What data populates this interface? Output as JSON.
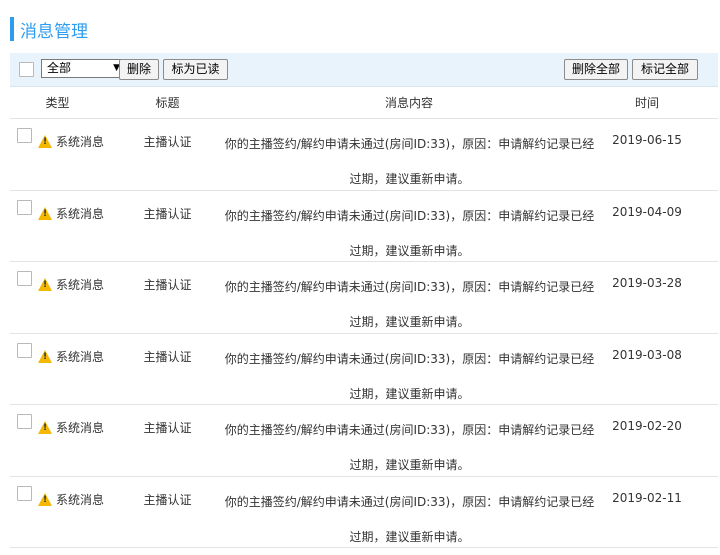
{
  "header": {
    "title": "消息管理"
  },
  "toolbar": {
    "filter_value": "全部",
    "delete_label": "删除",
    "mark_read_label": "标为已读",
    "delete_all_label": "删除全部",
    "mark_all_label": "标记全部"
  },
  "table": {
    "columns": {
      "type": "类型",
      "title": "标题",
      "content": "消息内容",
      "time": "时间"
    },
    "rows": [
      {
        "type": "系统消息",
        "title": "主播认证",
        "content": "你的主播签约/解约申请未通过(房间ID:33)，原因：申请解约记录已经过期，建议重新申请。",
        "time": "2019-06-15"
      },
      {
        "type": "系统消息",
        "title": "主播认证",
        "content": "你的主播签约/解约申请未通过(房间ID:33)，原因：申请解约记录已经过期，建议重新申请。",
        "time": "2019-04-09"
      },
      {
        "type": "系统消息",
        "title": "主播认证",
        "content": "你的主播签约/解约申请未通过(房间ID:33)，原因：申请解约记录已经过期，建议重新申请。",
        "time": "2019-03-28"
      },
      {
        "type": "系统消息",
        "title": "主播认证",
        "content": "你的主播签约/解约申请未通过(房间ID:33)，原因：申请解约记录已经过期，建议重新申请。",
        "time": "2019-03-08"
      },
      {
        "type": "系统消息",
        "title": "主播认证",
        "content": "你的主播签约/解约申请未通过(房间ID:33)，原因：申请解约记录已经过期，建议重新申请。",
        "time": "2019-02-20"
      },
      {
        "type": "系统消息",
        "title": "主播认证",
        "content": "你的主播签约/解约申请未通过(房间ID:33)，原因：申请解约记录已经过期，建议重新申请。",
        "time": "2019-02-11"
      }
    ]
  },
  "icons": {
    "row_icon": "warning-icon",
    "select_arrow": "triangle-down-icon"
  },
  "colors": {
    "accent": "#2d9cf0",
    "toolbar_bg": "#e9f3fb",
    "warning": "#f5b800"
  }
}
